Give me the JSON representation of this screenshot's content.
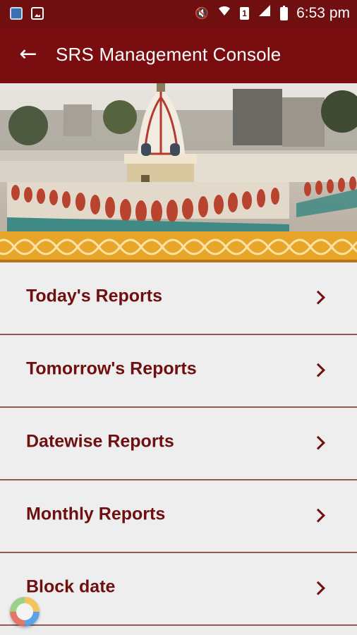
{
  "status_bar": {
    "left_icons": [
      "sync-icon",
      "gallery-icon"
    ],
    "right_icons": [
      "mute-icon",
      "wifi-icon",
      "sim-icon",
      "signal-icon",
      "battery-icon"
    ],
    "sim_label": "1",
    "time": "6:53 pm"
  },
  "app_bar": {
    "back_icon": "back-arrow-icon",
    "title": "SRS Management Console"
  },
  "banner": {
    "image": "temple-rooftop-photo"
  },
  "menu": {
    "items": [
      {
        "label": "Today's Reports"
      },
      {
        "label": "Tomorrow's Reports"
      },
      {
        "label": "Datewise Reports"
      },
      {
        "label": "Monthly Reports"
      },
      {
        "label": "Block date"
      }
    ],
    "chevron_icon": "chevron-right-icon"
  },
  "colors": {
    "primary": "#7a0d0f",
    "status_bar": "#6f0f10",
    "menu_bg": "#eeeeee",
    "menu_text": "#6f0f10",
    "pattern_gold": "#e7a52a"
  }
}
